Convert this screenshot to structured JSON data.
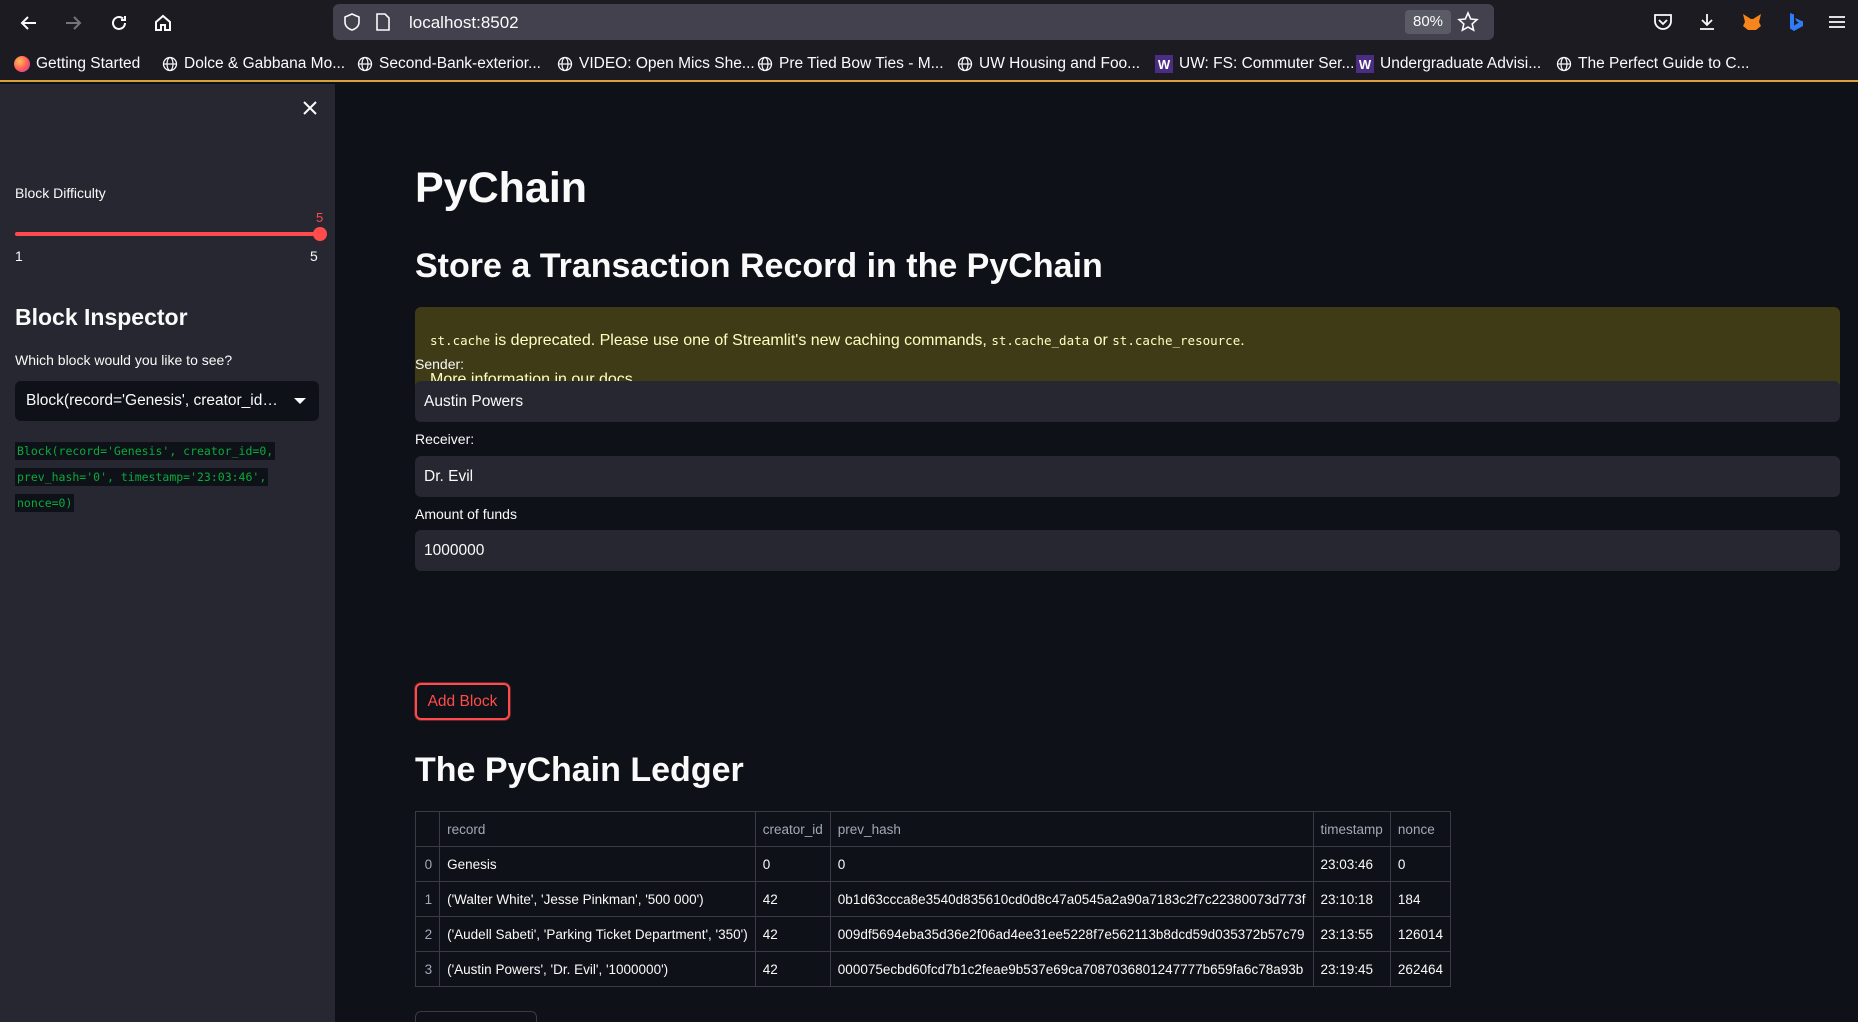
{
  "browser": {
    "url": "localhost:8502",
    "zoom": "80%",
    "bookmarks": [
      "Getting Started",
      "Dolce & Gabbana Mo...",
      "Second-Bank-exterior...",
      "VIDEO: Open Mics She...",
      "Pre Tied Bow Ties - M...",
      "UW Housing and Foo...",
      "UW: FS: Commuter Ser...",
      "Undergraduate Advisi...",
      "The Perfect Guide to C..."
    ]
  },
  "sidebar": {
    "difficulty_label": "Block Difficulty",
    "difficulty_value": "5",
    "difficulty_min": "1",
    "difficulty_max": "5",
    "difficulty_level": 1.0,
    "inspector_title": "Block Inspector",
    "inspector_question": "Which block would you like to see?",
    "selected_block": "Block(record='Genesis', creator_id=...",
    "block_code": [
      "Block(record='Genesis', creator_id=0,",
      "prev_hash='0', timestamp='23:03:46',",
      "nonce=0)"
    ]
  },
  "main": {
    "title": "PyChain",
    "store_title": "Store a Transaction Record in the PyChain",
    "warning": {
      "code1": "st.cache",
      "text1": " is deprecated. Please use one of Streamlit's new caching commands, ",
      "code2": "st.cache_data",
      "text2": " or ",
      "code3": "st.cache_resource",
      "text3": ".",
      "more": "More information ",
      "link": "in our docs",
      "end": "."
    },
    "sender_label": "Sender:",
    "sender_value": "Austin Powers",
    "receiver_label": "Receiver:",
    "receiver_value": "Dr. Evil",
    "amount_label": "Amount of funds",
    "amount_value": "1000000",
    "add_button": "Add Block",
    "ledger_title": "The PyChain Ledger"
  },
  "ledger": {
    "columns": [
      "",
      "record",
      "creator_id",
      "prev_hash",
      "timestamp",
      "nonce"
    ],
    "rows": [
      [
        "0",
        "Genesis",
        "0",
        "0",
        "23:03:46",
        "0"
      ],
      [
        "1",
        "('Walter White', 'Jesse Pinkman', '500 000')",
        "42",
        "0b1d63ccca8e3540d835610cd0d8c47a0545a2a90a7183c2f7c22380073d773f",
        "23:10:18",
        "184"
      ],
      [
        "2",
        "('Audell Sabeti', 'Parking Ticket Department', '350')",
        "42",
        "009df5694eba35d36e2f06ad4ee31ee5228f7e562113b8dcd59d035372b57c79",
        "23:13:55",
        "126014"
      ],
      [
        "3",
        "('Austin Powers', 'Dr. Evil', '1000000')",
        "42",
        "000075ecbd60fcd7b1c2feae9b537e69ca7087036801247777b659fa6c78a93b",
        "23:19:45",
        "262464"
      ]
    ]
  },
  "colors": {
    "accent": "#ff4b4b",
    "background": "#0e1117",
    "sidebar": "#262730",
    "warning_bg": "#3e3b16",
    "code_green": "#09ab3b"
  }
}
